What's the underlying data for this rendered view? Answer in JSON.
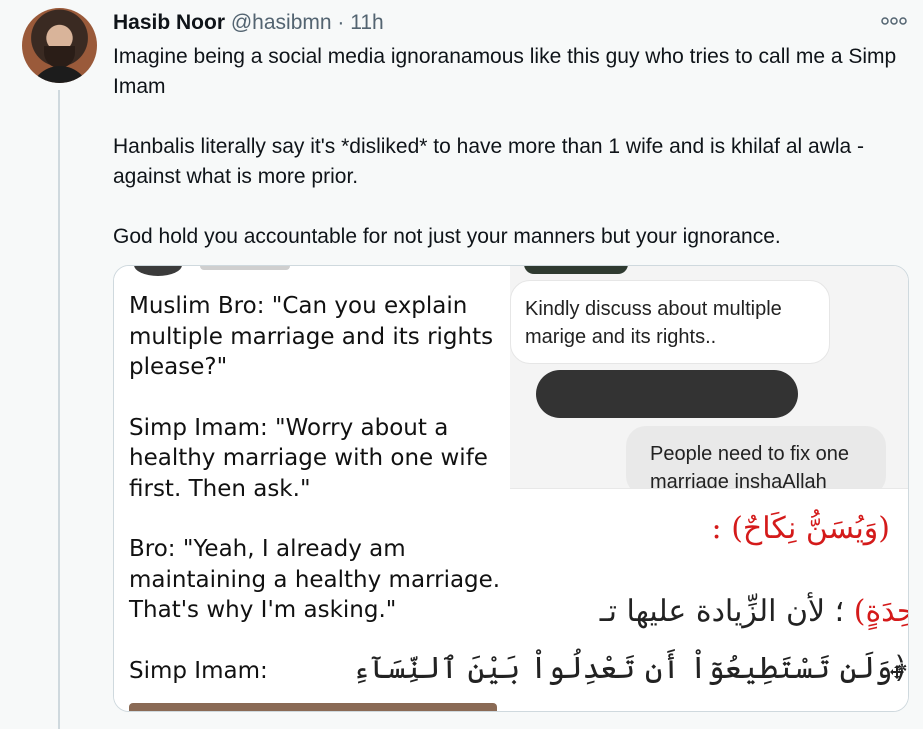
{
  "tweet": {
    "author_name": "Hasib Noor",
    "handle": "@hasibmn",
    "separator": "·",
    "time": "11h",
    "more_icon": "more-options-icon",
    "paragraphs": [
      "Imagine being a social media ignoranamous like this guy who tries to call me a Simp Imam",
      "Hanbalis literally say it's *disliked* to have more than 1 wife and is khilaf al awla - against what is more prior.",
      "God hold you accountable for not just your manners but your ignorance."
    ]
  },
  "media": {
    "meme_lines": [
      "Muslim Bro: \"Can you explain multiple marriage and its rights please?\"",
      "Simp Imam: \"Worry about a healthy marriage with one wife first. Then ask.\"",
      "Bro: \"Yeah, I already am maintaining a healthy marriage. That's why I'm asking.\"",
      "Simp Imam:"
    ],
    "chat_incoming": "Kindly discuss about multiple marige and its rights..",
    "chat_outgoing": "People need to fix one marriage inshaAllah",
    "arabic_heading": "(وَيُسَنُّ نِكَاحٌ) :",
    "arabic_red_word": "(وَاحِدَةٍ)",
    "arabic_line2_rest": "؛ لأن الزِّيادة عليها تـ",
    "arabic_line3": "﴿وَلَن تَسْتَطِيعُوٓاْ أَن تَعْدِلُواْ بَيْنَ ٱلنِّسَآءِ"
  }
}
